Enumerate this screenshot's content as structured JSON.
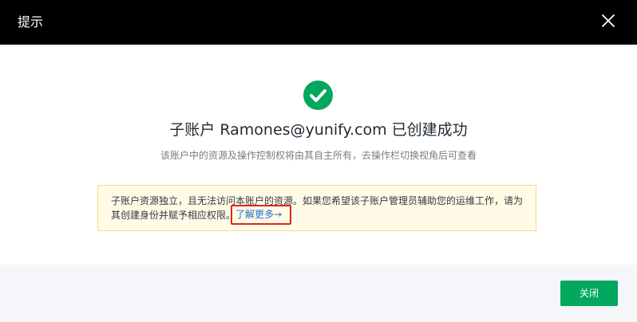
{
  "dialog": {
    "header": {
      "title": "提示"
    },
    "content": {
      "title": "子账户 Ramones@yunify.com 已创建成功",
      "subtitle": "该账户中的资源及操作控制权将由其自主所有，去操作栏切换视角后可查看",
      "notice": {
        "line1": "子账户资源独立，且无法访问本账户的资源。如果您希望该子账户管理员辅助您的运维工作，请为",
        "line2_prefix": "其创建身份并赋予相应权限。",
        "link_label": "了解更多→"
      }
    },
    "footer": {
      "close_label": "关闭"
    }
  },
  "colors": {
    "header_bg": "#000000",
    "success_green": "#03a75e",
    "notice_bg": "#fffbe6",
    "notice_border": "#f5d98b",
    "link_blue": "#1f6fd6",
    "highlight_red": "#e1251b",
    "footer_bg": "#f4f6f9"
  },
  "icons": {
    "close": "close-icon",
    "success": "check-circle-icon"
  }
}
